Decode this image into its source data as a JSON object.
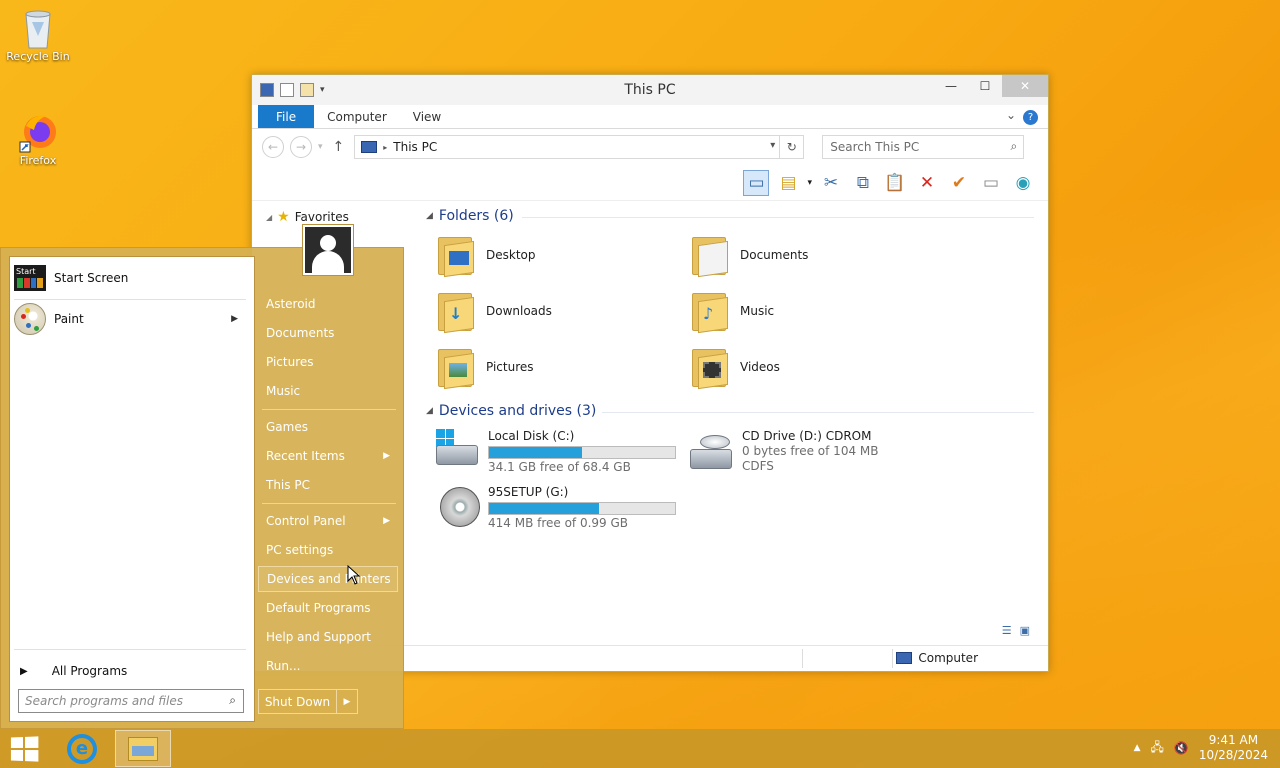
{
  "desktop": {
    "icons": [
      {
        "label": "Recycle Bin"
      },
      {
        "label": "Firefox"
      }
    ]
  },
  "explorer": {
    "title": "This PC",
    "ribbon_tabs": [
      "File",
      "Computer",
      "View"
    ],
    "help_glyph": "?",
    "address": "This PC",
    "search_placeholder": "Search This PC",
    "nav": {
      "favorites": "Favorites"
    },
    "folders_header": "Folders (6)",
    "folders": [
      {
        "name": "Desktop",
        "icon": "desktop-folder-icon"
      },
      {
        "name": "Documents",
        "icon": "documents-folder-icon"
      },
      {
        "name": "Downloads",
        "icon": "downloads-folder-icon"
      },
      {
        "name": "Music",
        "icon": "music-folder-icon"
      },
      {
        "name": "Pictures",
        "icon": "pictures-folder-icon"
      },
      {
        "name": "Videos",
        "icon": "videos-folder-icon"
      }
    ],
    "drives_header": "Devices and drives (3)",
    "drives": [
      {
        "name": "Local Disk (C:)",
        "detail": "34.1 GB free of 68.4 GB",
        "used_fraction": 0.5
      },
      {
        "name": "CD Drive (D:) CDROM",
        "detail": "0 bytes free of 104 MB",
        "fs": "CDFS"
      },
      {
        "name": "95SETUP (G:)",
        "detail": "414 MB free of 0.99 GB",
        "used_fraction": 0.59
      }
    ],
    "status": {
      "location": "Computer"
    }
  },
  "start_menu": {
    "left_items": [
      {
        "label": "Start Screen",
        "tile_label": "Start"
      },
      {
        "label": "Paint"
      }
    ],
    "all_programs": "All Programs",
    "search_placeholder": "Search programs and files",
    "right_items": [
      {
        "label": "Asteroid"
      },
      {
        "label": "Documents"
      },
      {
        "label": "Pictures"
      },
      {
        "label": "Music"
      },
      {
        "label": "Games"
      },
      {
        "label": "Recent Items"
      },
      {
        "label": "This PC"
      },
      {
        "label": "Control Panel"
      },
      {
        "label": "PC settings"
      },
      {
        "label": "Devices and Printers"
      },
      {
        "label": "Default Programs"
      },
      {
        "label": "Help and Support"
      },
      {
        "label": "Run..."
      }
    ],
    "shutdown": "Shut Down"
  },
  "taskbar": {
    "time": "9:41 AM",
    "date": "10/28/2024"
  },
  "colors": {
    "accent": "#1979ca",
    "drive_bar": "#26a0da",
    "desktop": "#f8aa12"
  }
}
